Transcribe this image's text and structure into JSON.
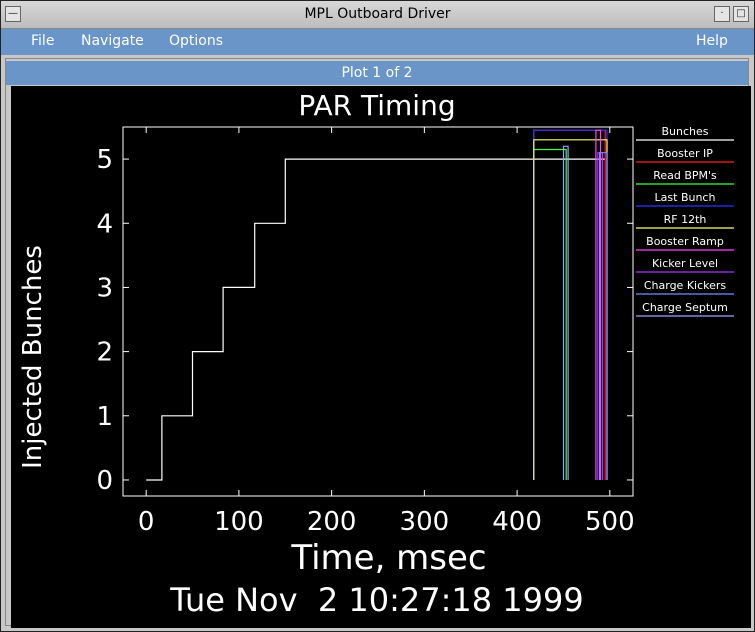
{
  "window": {
    "title": "MPL Outboard Driver"
  },
  "menubar": {
    "file": "File",
    "navigate": "Navigate",
    "options": "Options",
    "help": "Help"
  },
  "plot_header": "Plot 1 of 2",
  "timestamp": "Tue Nov  2 10:27:18 1999",
  "chart_data": {
    "type": "line",
    "title": "PAR  Timing",
    "xlabel": "Time,  msec",
    "ylabel": "Injected  Bunches",
    "xlim": [
      -25,
      525
    ],
    "ylim": [
      -0.25,
      5.5
    ],
    "xticks": [
      0,
      100,
      200,
      300,
      400,
      500
    ],
    "xtick_labels": [
      "0",
      "100",
      "200",
      "300",
      "400",
      "500"
    ],
    "yticks": [
      0,
      1,
      2,
      3,
      4,
      5
    ],
    "ytick_labels": [
      "0",
      "1",
      "2",
      "3",
      "4",
      "5"
    ],
    "legend_position": "right",
    "series": [
      {
        "name": "Bunches",
        "color": "#ffffff",
        "kind": "step",
        "points": [
          [
            0,
            0
          ],
          [
            17,
            0
          ],
          [
            17,
            1
          ],
          [
            50,
            1
          ],
          [
            50,
            2
          ],
          [
            83,
            2
          ],
          [
            83,
            3
          ],
          [
            117,
            3
          ],
          [
            117,
            4
          ],
          [
            150,
            4
          ],
          [
            150,
            5
          ],
          [
            495,
            5
          ]
        ]
      },
      {
        "name": "Booster IP",
        "color": "#ff2020",
        "kind": "pulse",
        "x": [
          418,
          495
        ],
        "ymax": 5.45
      },
      {
        "name": "Read BPM's",
        "color": "#40ff40",
        "kind": "pulse",
        "x": [
          418,
          453
        ],
        "ymax": 5.15
      },
      {
        "name": "Last Bunch",
        "color": "#3030ff",
        "kind": "pulse",
        "x": [
          418,
          497
        ],
        "ymax": 5.45
      },
      {
        "name": "RF 12th",
        "color": "#ffff60",
        "kind": "pulse",
        "x": [
          418,
          497
        ],
        "ymax": 5.3
      },
      {
        "name": "Booster Ramp",
        "color": "#ff40ff",
        "kind": "pulse",
        "x": [
          485,
          490
        ],
        "ymax": 5.45
      },
      {
        "name": "Kicker Level",
        "color": "#b030ff",
        "kind": "pulse",
        "x": [
          487,
          492
        ],
        "ymax": 5.1
      },
      {
        "name": "Charge Kickers",
        "color": "#7090ff",
        "kind": "pulse",
        "x": [
          489,
          497
        ],
        "ymax": 5.1
      },
      {
        "name": "Charge Septum",
        "color": "#9f9fff",
        "kind": "pulse",
        "x": [
          450,
          455
        ],
        "ymax": 5.2
      }
    ]
  }
}
